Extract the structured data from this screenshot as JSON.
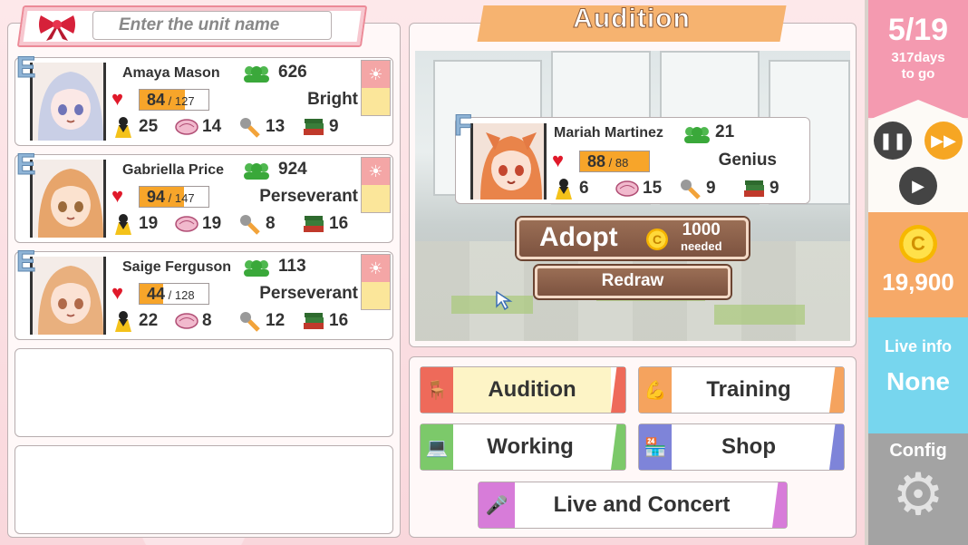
{
  "search": {
    "placeholder": "Enter the unit name"
  },
  "units": [
    {
      "rank": "E",
      "name": "Amaya Mason",
      "fans": "626",
      "hp": "84",
      "hp_max": "127",
      "hp_ratio": 0.66,
      "trait": "Bright",
      "stats": [
        "25",
        "14",
        "13",
        "9"
      ]
    },
    {
      "rank": "E",
      "name": "Gabriella Price",
      "fans": "924",
      "hp": "94",
      "hp_max": "147",
      "hp_ratio": 0.64,
      "trait": "Perseverant",
      "stats": [
        "19",
        "19",
        "8",
        "16"
      ]
    },
    {
      "rank": "E",
      "name": "Saige Ferguson",
      "fans": "113",
      "hp": "44",
      "hp_max": "128",
      "hp_ratio": 0.34,
      "trait": "Perseverant",
      "stats": [
        "22",
        "8",
        "12",
        "16"
      ]
    }
  ],
  "audition": {
    "title": "Audition",
    "candidate": {
      "rank": "F",
      "name": "Mariah Martinez",
      "fans": "21",
      "hp": "88",
      "hp_max": "88",
      "hp_ratio": 1.0,
      "trait": "Genius",
      "stats": [
        "6",
        "15",
        "9",
        "9"
      ]
    },
    "adopt_label": "Adopt",
    "adopt_cost": "1000",
    "adopt_cost_note": "needed",
    "redraw_label": "Redraw"
  },
  "menu": {
    "audition": "Audition",
    "training": "Training",
    "working": "Working",
    "shop": "Shop",
    "live": "Live and Concert"
  },
  "sidebar": {
    "date": "5/19",
    "days_left_1": "317days",
    "days_left_2": "to go",
    "gold": "19,900",
    "live_info_title": "Live info",
    "live_info_value": "None",
    "config_label": "Config"
  }
}
